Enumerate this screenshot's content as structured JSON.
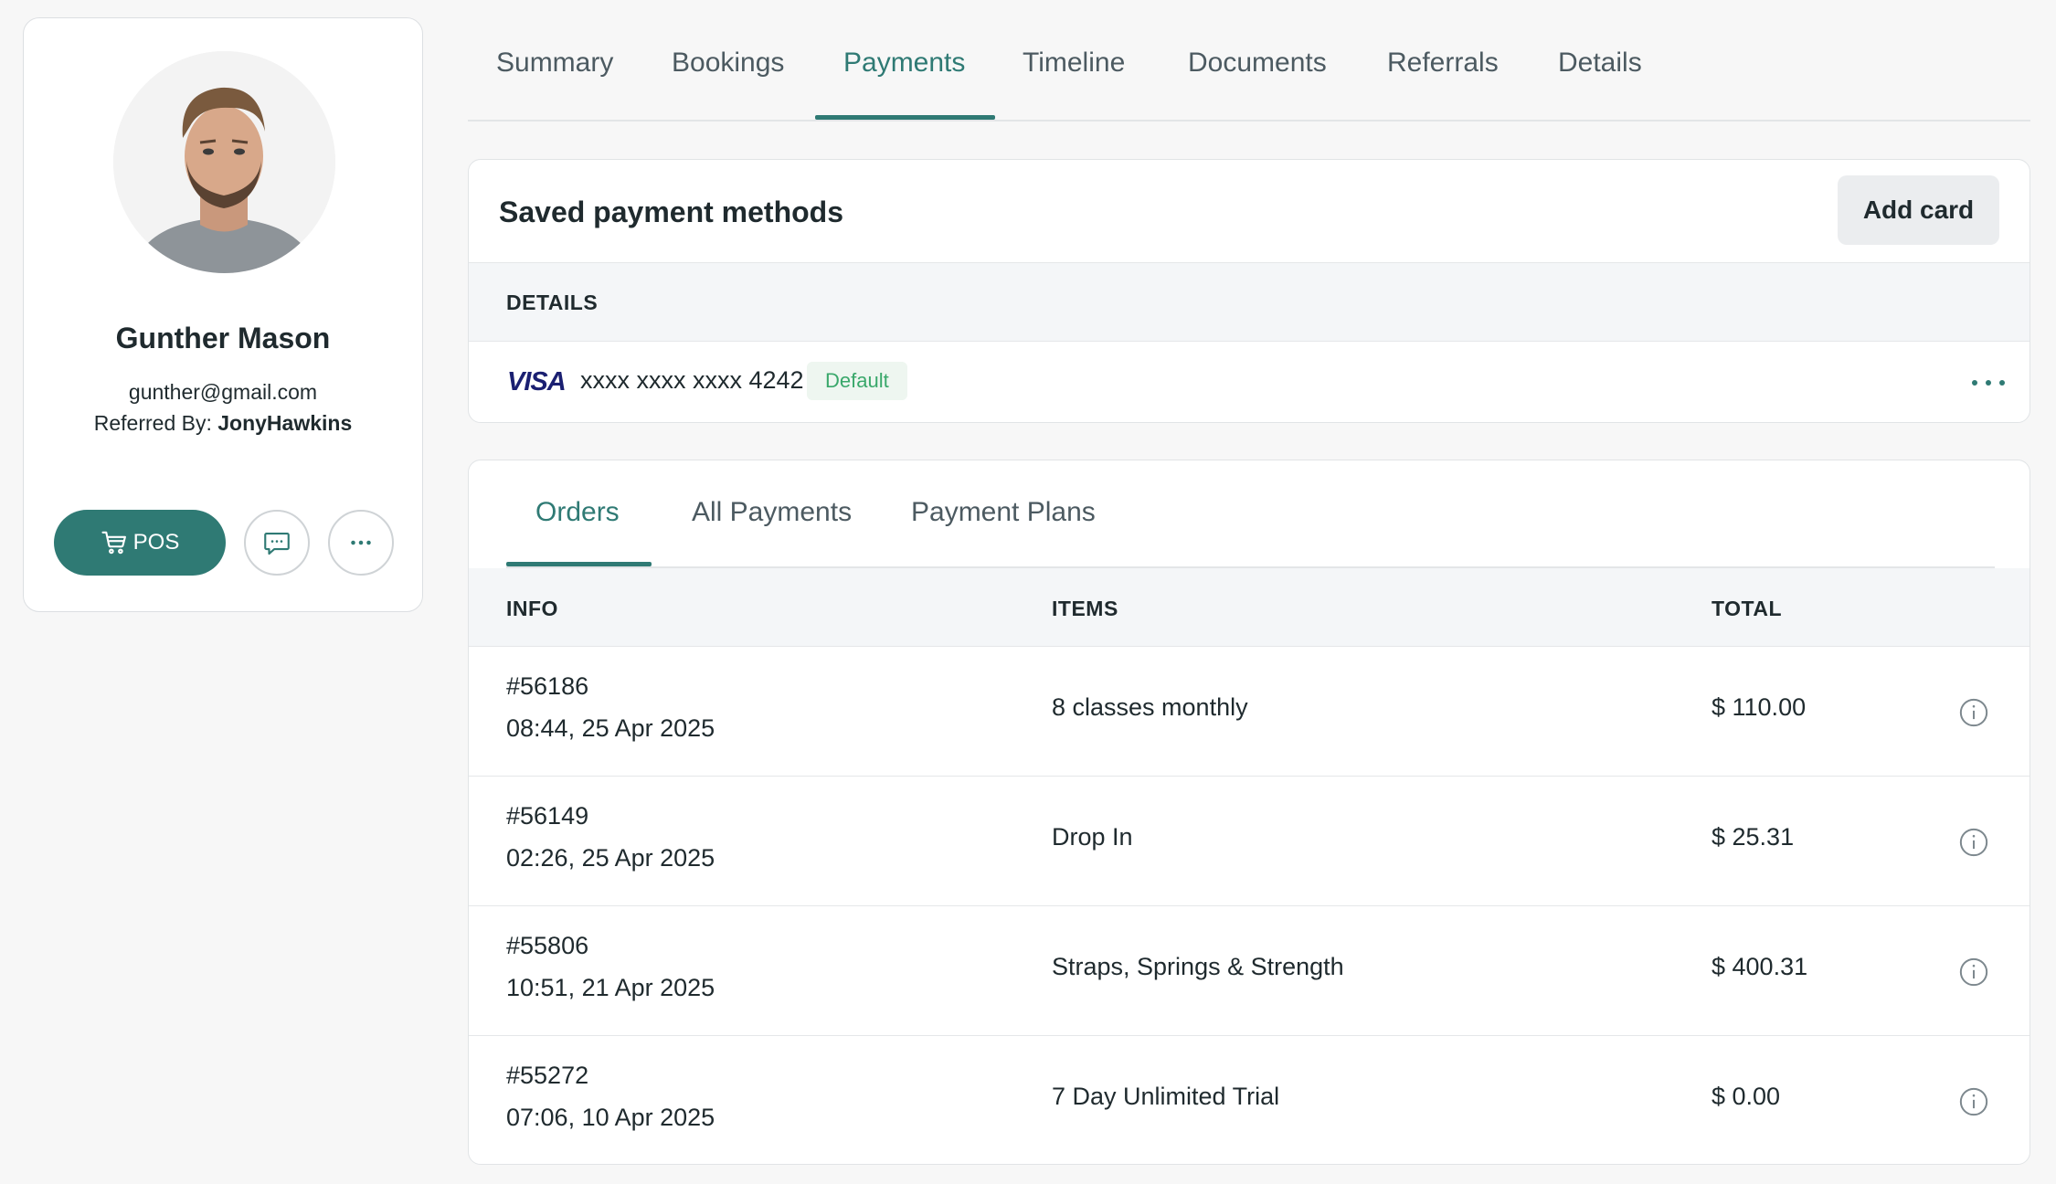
{
  "profile": {
    "name": "Gunther Mason",
    "email": "gunther@gmail.com",
    "referred_label": "Referred By: ",
    "referred_by": "JonyHawkins",
    "pos_label": "POS"
  },
  "top_tabs": [
    {
      "label": "Summary"
    },
    {
      "label": "Bookings"
    },
    {
      "label": "Payments",
      "active": true
    },
    {
      "label": "Timeline"
    },
    {
      "label": "Documents"
    },
    {
      "label": "Referrals"
    },
    {
      "label": "Details"
    }
  ],
  "payment_methods": {
    "title": "Saved payment methods",
    "add_card_label": "Add card",
    "details_header": "DETAILS",
    "card": {
      "brand": "VISA",
      "number": "xxxx xxxx xxxx 4242",
      "badge": "Default"
    }
  },
  "orders": {
    "tabs": [
      {
        "label": "Orders",
        "active": true
      },
      {
        "label": "All Payments"
      },
      {
        "label": "Payment Plans"
      }
    ],
    "columns": {
      "info": "INFO",
      "items": "ITEMS",
      "total": "TOTAL"
    },
    "rows": [
      {
        "id": "#56186",
        "date": "08:44, 25 Apr 2025",
        "items": "8 classes monthly",
        "total": "$ 110.00"
      },
      {
        "id": "#56149",
        "date": "02:26, 25 Apr 2025",
        "items": "Drop In",
        "total": "$ 25.31"
      },
      {
        "id": "#55806",
        "date": "10:51, 21 Apr 2025",
        "items": "Straps, Springs & Strength",
        "total": "$ 400.31"
      },
      {
        "id": "#55272",
        "date": "07:06, 10 Apr 2025",
        "items": "7 Day Unlimited Trial",
        "total": "$ 0.00"
      }
    ]
  },
  "colors": {
    "accent": "#2f7a74",
    "badge_green": "#3aa86b",
    "visa_blue": "#1a1f71"
  },
  "icons": [
    "cart-icon",
    "chat-icon",
    "more-horizontal-icon",
    "info-icon",
    "visa-logo"
  ]
}
